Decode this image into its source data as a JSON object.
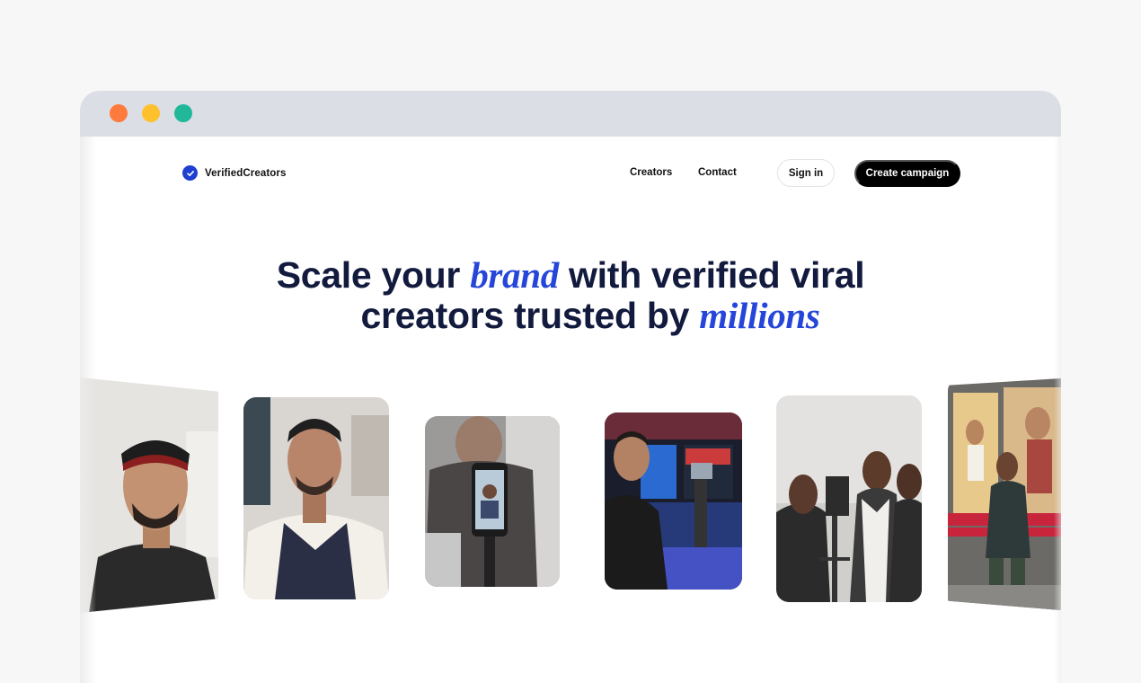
{
  "brand": {
    "name": "VerifiedCreators",
    "icon": "check-badge-icon",
    "color": "#1f3fd1"
  },
  "nav": {
    "creators": "Creators",
    "contact": "Contact",
    "sign_in": "Sign in",
    "create_campaign": "Create campaign"
  },
  "hero": {
    "part1": "Scale your ",
    "em1": "brand",
    "part2": " with verified viral",
    "part3": "creators trusted by ",
    "em2": "millions",
    "accent": "#2546d9"
  },
  "window_controls": [
    "close-dot",
    "minimize-dot",
    "maximize-dot"
  ],
  "creator_photos": [
    "creator-photo-headband",
    "creator-photo-vest",
    "creator-photo-phone-gimbal",
    "creator-photo-studio",
    "creator-photo-camera-crew",
    "creator-photo-bench"
  ]
}
